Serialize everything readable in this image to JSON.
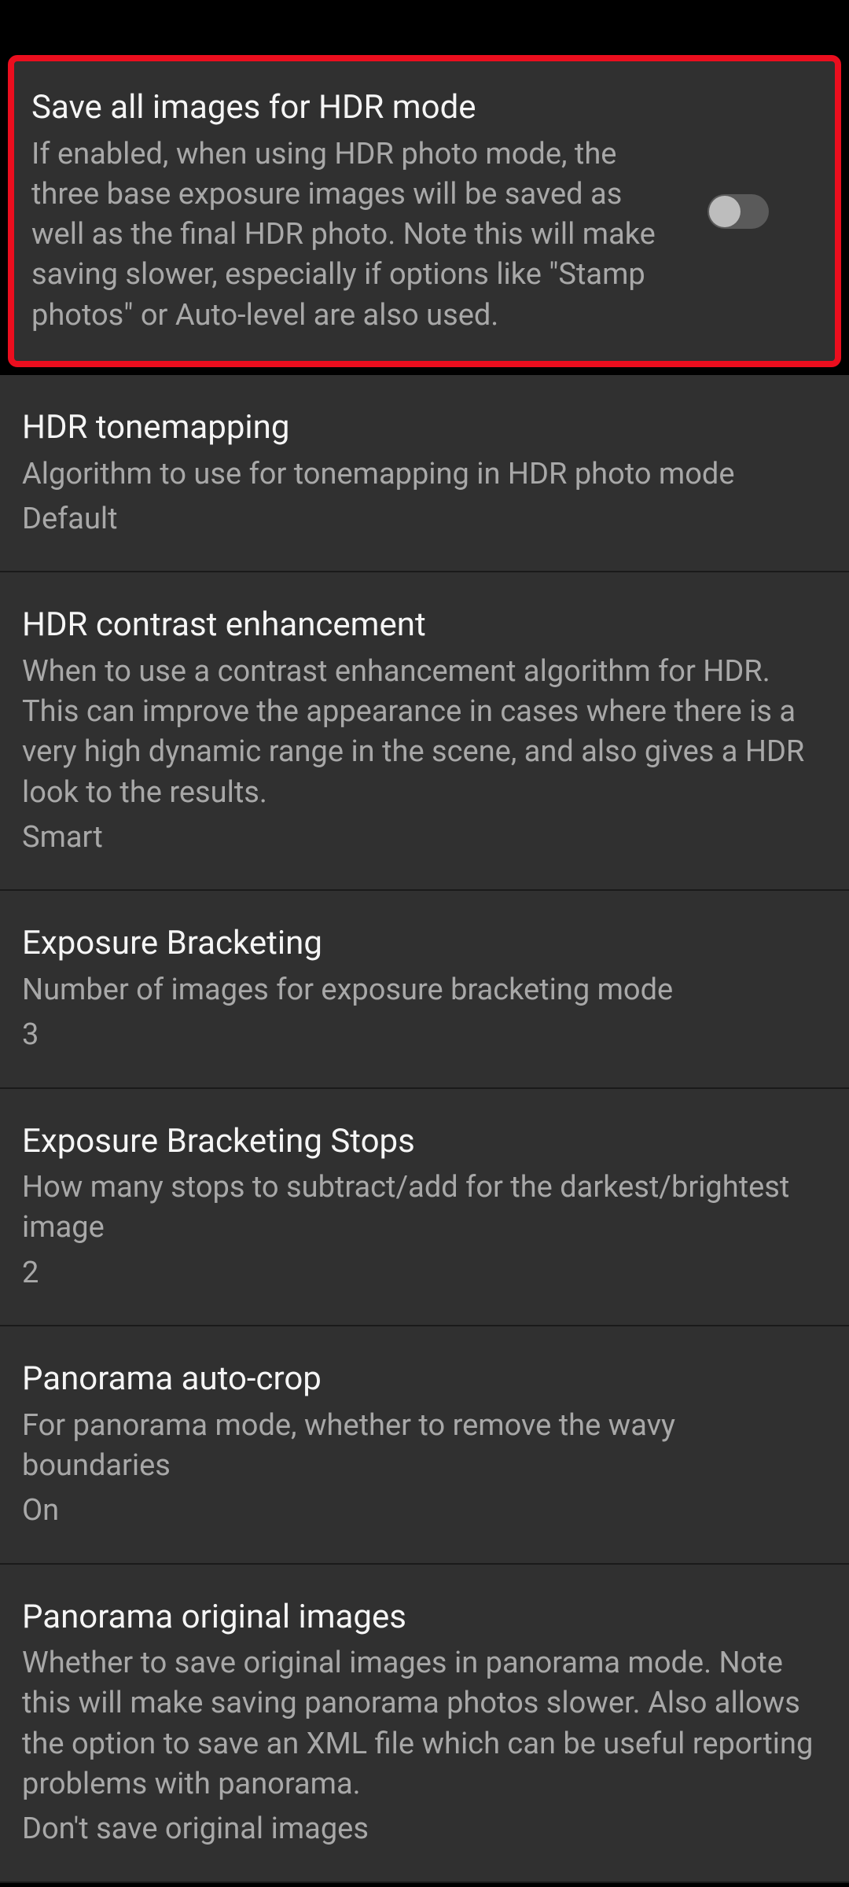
{
  "settings": [
    {
      "title": "Save all images for HDR mode",
      "desc": "If enabled, when using HDR photo mode, the three base exposure images will be saved as well as the final HDR photo. Note this will make saving slower, especially if options like \"Stamp photos\" or Auto-level are also used.",
      "toggle": false
    },
    {
      "title": "HDR tonemapping",
      "desc": "Algorithm to use for tonemapping in HDR photo mode",
      "value": "Default"
    },
    {
      "title": "HDR contrast enhancement",
      "desc": "When to use a contrast enhancement algorithm for HDR. This can improve the appearance in cases where there is a very high dynamic range in the scene, and also gives a HDR look to the results.",
      "value": "Smart"
    },
    {
      "title": "Exposure Bracketing",
      "desc": "Number of images for exposure bracketing mode",
      "value": "3"
    },
    {
      "title": "Exposure Bracketing Stops",
      "desc": "How many stops to subtract/add for the darkest/brightest image",
      "value": "2"
    },
    {
      "title": "Panorama auto-crop",
      "desc": "For panorama mode, whether to remove the wavy boundaries",
      "value": "On"
    },
    {
      "title": "Panorama original images",
      "desc": "Whether to save original images in panorama mode. Note this will make saving panorama photos slower. Also allows the option to save an XML file which can be useful reporting problems with panorama.",
      "value": "Don't save original images"
    }
  ]
}
